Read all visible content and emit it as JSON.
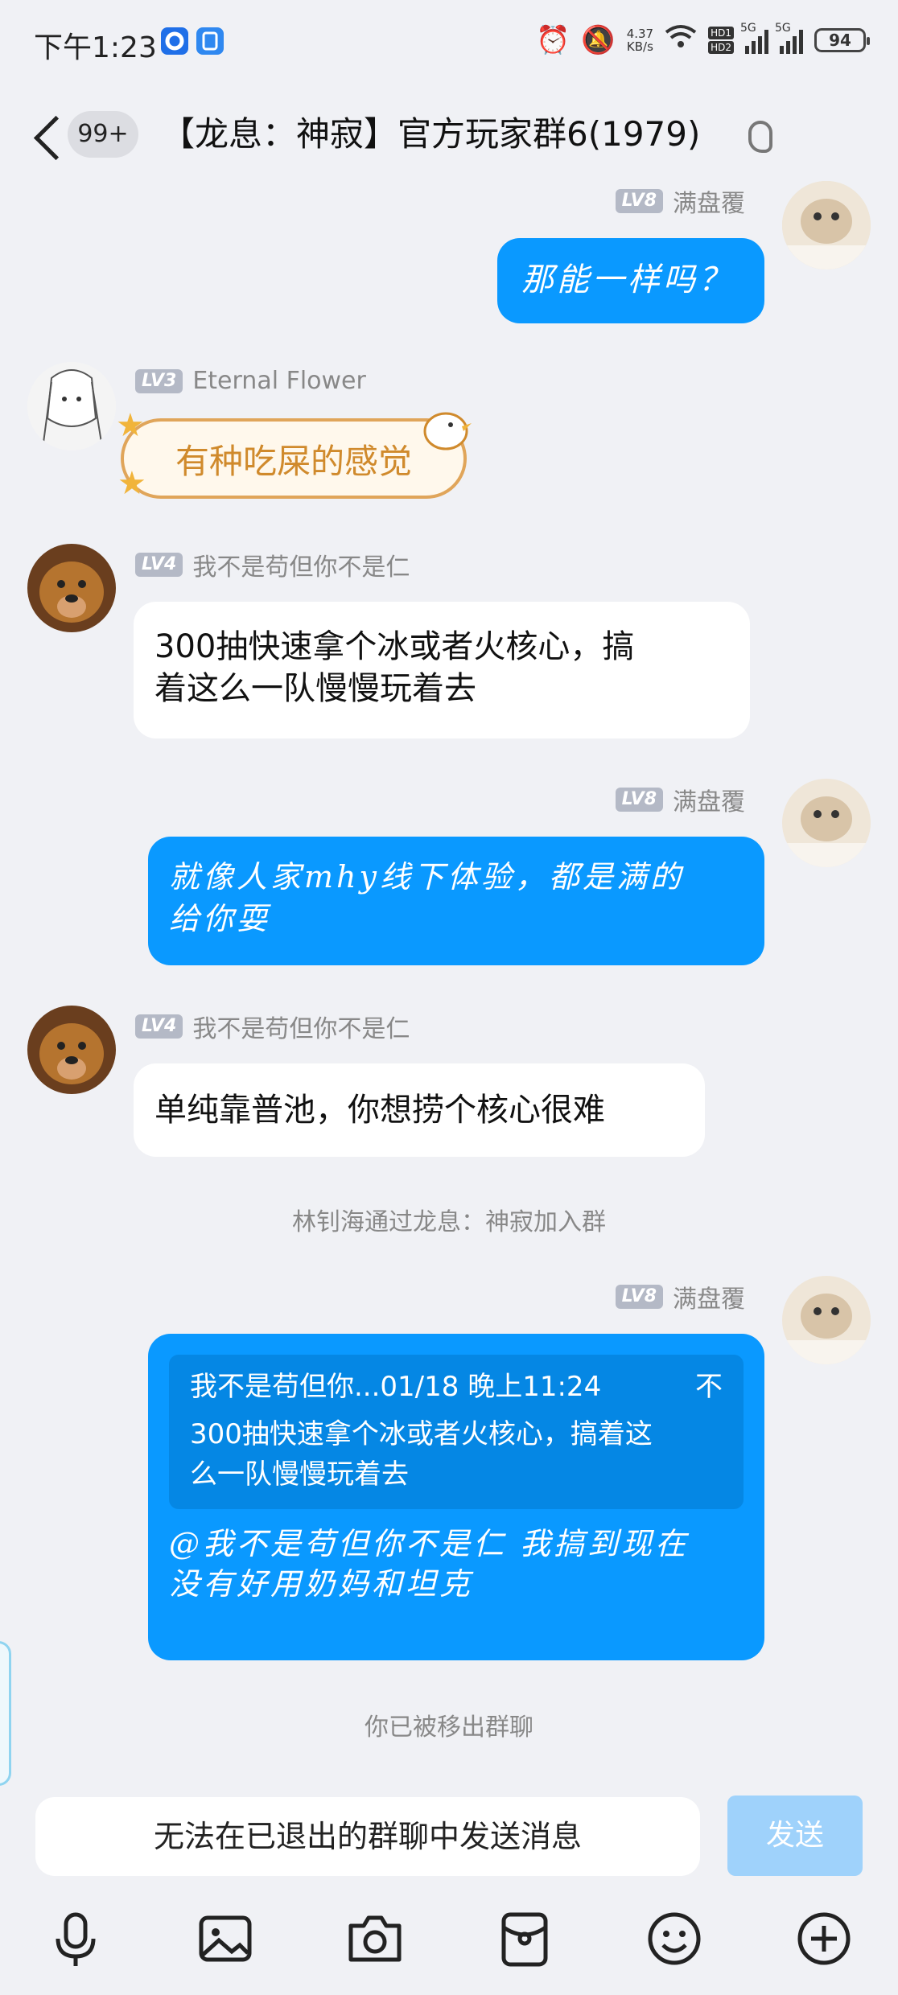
{
  "status_bar": {
    "time": "下午1:23",
    "net_speed_value": "4.37",
    "net_speed_unit": "KB/s",
    "hd1": "HD1",
    "hd2": "HD2",
    "signal_tag": "5G",
    "battery": "94"
  },
  "header": {
    "unread_count": "99+",
    "group_title": "【龙息：神寂】官方玩家群6(1979)"
  },
  "messages": [
    {
      "side": "right",
      "level": "LV8",
      "sender": "满盘覆",
      "text": "那能一样吗？"
    },
    {
      "side": "left",
      "level": "LV3",
      "sender": "Eternal Flower",
      "sticker_text": "有种吃屎的感觉"
    },
    {
      "side": "left",
      "level": "LV4",
      "sender": "我不是苟但你不是仁",
      "text_line1": "300抽快速拿个冰或者火核心，搞",
      "text_line2": "着这么一队慢慢玩着去"
    },
    {
      "side": "right",
      "level": "LV8",
      "sender": "满盘覆",
      "text_line1": "就像人家mhy线下体验，都是满的",
      "text_line2": "给你耍"
    },
    {
      "side": "left",
      "level": "LV4",
      "sender": "我不是苟但你不是仁",
      "text": "单纯靠普池，你想捞个核心很难"
    },
    {
      "side": "system",
      "text": "林钊海通过龙息：神寂加入群"
    },
    {
      "side": "right",
      "level": "LV8",
      "sender": "满盘覆",
      "quote_head": "我不是苟但你...01/18 晚上11:24",
      "quote_more": "不",
      "quote_line1": "300抽快速拿个冰或者火核心，搞着这",
      "quote_line2": "么一队慢慢玩着去",
      "text_line1": "@我不是苟但你不是仁 我搞到现在",
      "text_line2": "没有好用奶妈和坦克"
    },
    {
      "side": "system",
      "text": "你已被移出群聊"
    }
  ],
  "input": {
    "placeholder": "无法在已退出的群聊中发送消息",
    "send_label": "发送"
  },
  "toolbar": [
    "mic-icon",
    "image-icon",
    "camera-icon",
    "red-packet-icon",
    "emoji-icon",
    "plus-icon"
  ],
  "colors": {
    "accent": "#0a99ff",
    "background": "#f0f1f5",
    "send_disabled": "#9fd2fb"
  }
}
